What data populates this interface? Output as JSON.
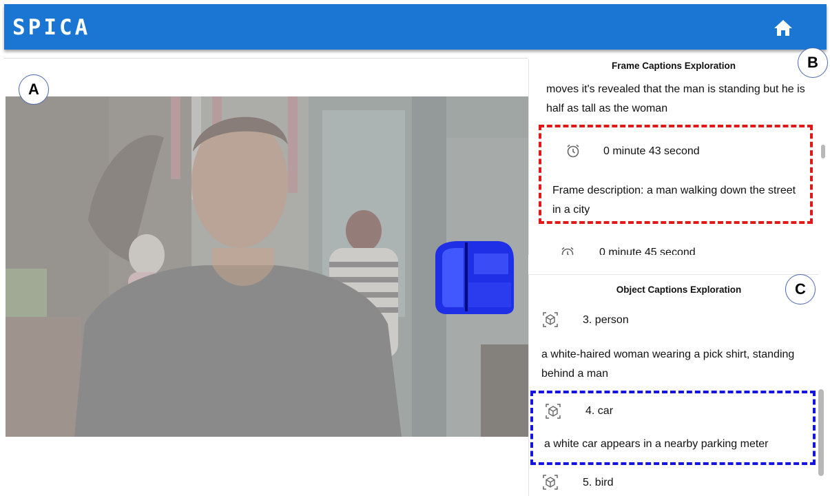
{
  "app": {
    "brand": "SPICA",
    "home_icon": "home-icon"
  },
  "markers": {
    "a": "A",
    "b": "B",
    "c": "C"
  },
  "frame_panel": {
    "title": "Frame Captions Exploration",
    "cut_text": "moves it's revealed that the man is standing but he is half as tall as the woman",
    "highlighted": {
      "time": "0 minute 43 second",
      "description": "Frame description: a man walking down the street in a city"
    },
    "next_time": "0 minute 45 second",
    "icon": "alarm-clock-icon",
    "highlight_color": "#e01818"
  },
  "object_panel": {
    "title": "Object Captions Exploration",
    "items": [
      {
        "label": "3. person",
        "caption": "a white-haired woman wearing a pick shirt, standing behind a man"
      },
      {
        "label": "4. car",
        "caption": "a white car appears in a nearby parking meter"
      },
      {
        "label": "5. bird",
        "caption": ""
      }
    ],
    "icon": "3d-box-icon",
    "highlight_color": "#1414e0"
  }
}
